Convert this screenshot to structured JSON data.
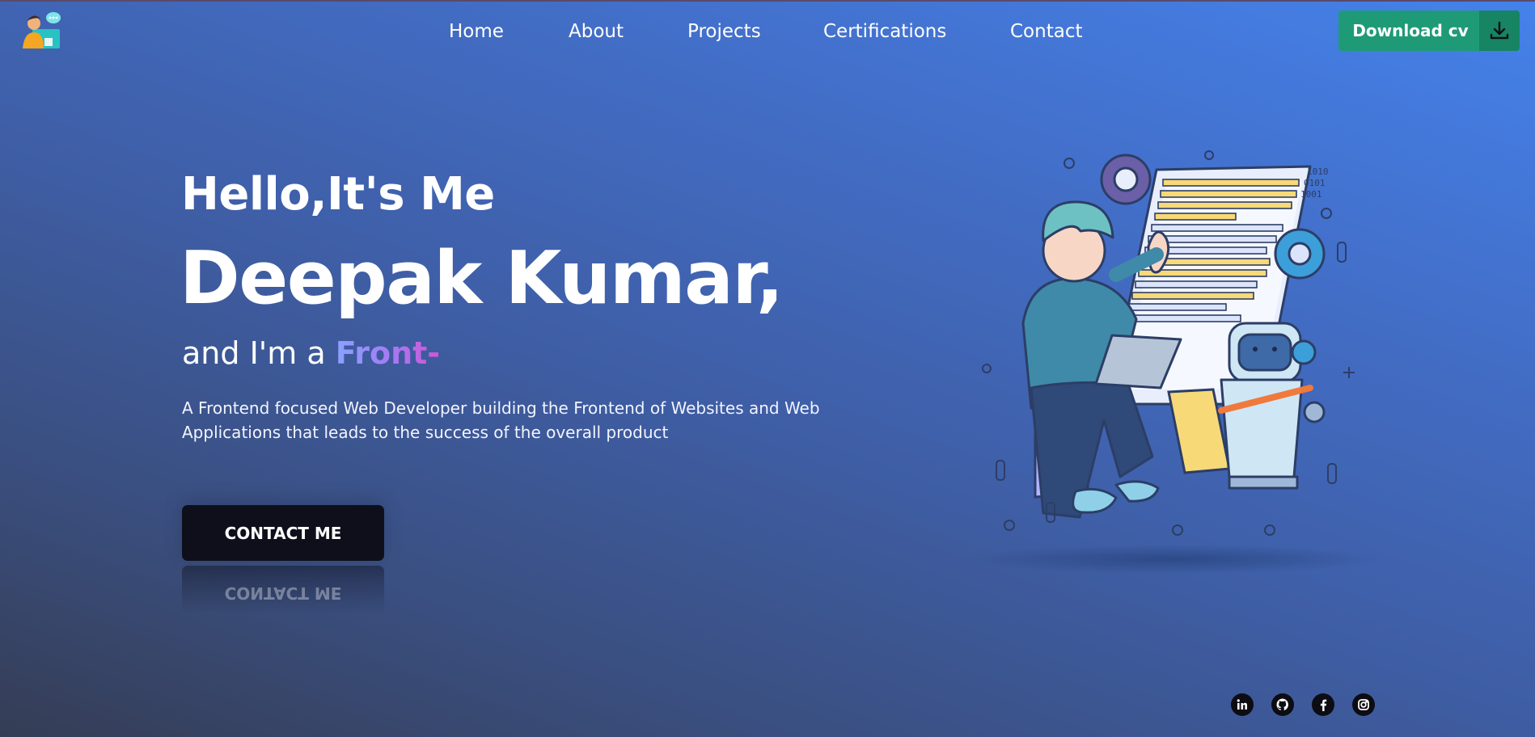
{
  "nav": {
    "items": [
      {
        "label": "Home"
      },
      {
        "label": "About"
      },
      {
        "label": "Projects"
      },
      {
        "label": "Certifications"
      },
      {
        "label": "Contact"
      }
    ]
  },
  "header": {
    "download_label": "Download cv",
    "logo_icon": "developer-avatar-icon",
    "download_icon": "download-icon"
  },
  "hero": {
    "greeting": "Hello,It's Me",
    "name": "Deepak Kumar,",
    "role_prefix": "and I'm a",
    "role_word": "Front-",
    "description": "A Frontend focused Web Developer building the Frontend of Websites and Web Applications that leads to the success of the overall product",
    "contact_label": "CONTACT ME"
  },
  "socials": [
    {
      "icon": "linkedin-icon"
    },
    {
      "icon": "github-icon"
    },
    {
      "icon": "facebook-icon"
    },
    {
      "icon": "instagram-icon"
    }
  ],
  "colors": {
    "accent_green": "#1f9a77",
    "button_dark": "#0f0f1c",
    "gradient_start": "#8aa2ff",
    "gradient_end": "#d554d4"
  }
}
